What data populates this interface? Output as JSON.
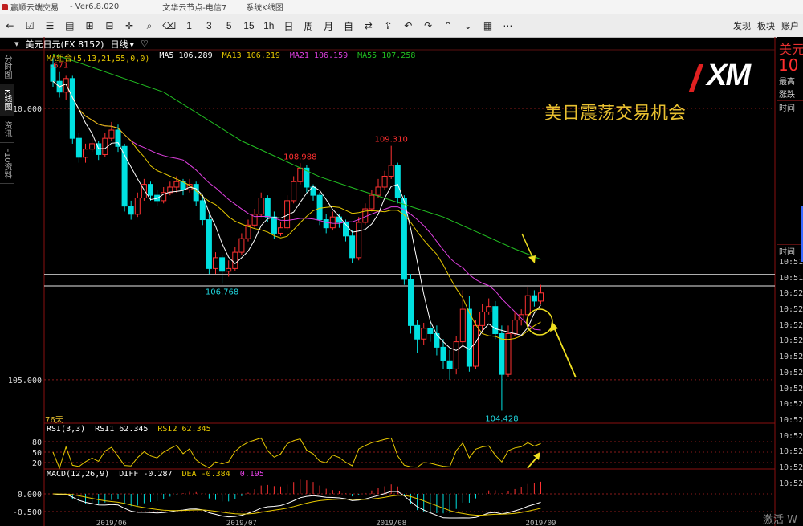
{
  "window": {
    "app_title": "赢顺云端交易",
    "version": "- Ver6.8.020",
    "node": "文华云节点-电信7",
    "chart_type": "系统K线图"
  },
  "toolbar": {
    "left_icons": [
      "back-icon",
      "checkbox-icon",
      "list-icon",
      "document-icon",
      "plus-icon",
      "minus-icon",
      "crosshair-icon",
      "search-icon",
      "eraser-icon"
    ],
    "periods": [
      "1",
      "3",
      "5",
      "15",
      "1h",
      "日",
      "周",
      "月",
      "自"
    ],
    "right_icons": [
      "swap-icon",
      "upload-icon",
      "undo-icon",
      "redo-icon",
      "chevron-up-icon",
      "chevron-down-icon",
      "grid-icon",
      "more-icon"
    ],
    "right_links": [
      "发现",
      "板块",
      "账户"
    ]
  },
  "left_tabs": [
    "分时图",
    "K线图",
    "资讯",
    "F10资料"
  ],
  "symbol": {
    "name": "美元日元(FX 8152)",
    "period": "日线"
  },
  "ma_legend": {
    "group": "MA组合(5,13,21,55,0,0)",
    "ma5": "MA5 106.289",
    "ma13": "MA13 106.219",
    "ma21": "MA21 106.159",
    "ma55": "MA55 107.258"
  },
  "rsi_legend": {
    "name": "RSI(3,3)",
    "rsi1": "RSI1 62.345",
    "rsi2": "RSI2 62.345"
  },
  "macd_legend": {
    "name": "MACD(12,26,9)",
    "diff": "DIFF -0.287",
    "dea": "DEA -0.384",
    "macd": "0.195"
  },
  "overlay": {
    "caption": "美日震荡交易机会",
    "logo": "XM",
    "days": "76天"
  },
  "side_panel": {
    "symbol": "美元",
    "price": "10",
    "high_label": "最高",
    "change_label": "涨跌",
    "time_header": "时间",
    "time_header2": "时间",
    "times": [
      "10:51",
      "10:51",
      "10:52",
      "10:52",
      "10:52",
      "10:52",
      "10:52",
      "10:52",
      "10:52",
      "10:52",
      "10:52",
      "10:52",
      "10:52",
      "10:52",
      "10:52"
    ]
  },
  "watermark": "激活 W",
  "colors": {
    "up": "#ff3232",
    "down": "#00e0e0",
    "ma5": "#ffffff",
    "ma13": "#e6c800",
    "ma21": "#e040e0",
    "ma55": "#22c022",
    "annotation_arrow": "#f0e020",
    "grid": "#8a1a1a"
  },
  "chart_data": {
    "type": "candlestick",
    "ylim": [
      104.2,
      111.08
    ],
    "y_axis": {
      "ticks": [
        {
          "value": 110.0,
          "label": "110.000"
        },
        {
          "value": 105.0,
          "label": "105.000"
        }
      ]
    },
    "ohlc": [
      [
        110.8,
        110.95,
        110.4,
        110.5
      ],
      [
        110.5,
        110.67,
        110.2,
        110.3
      ],
      [
        110.3,
        110.6,
        110.15,
        110.55
      ],
      [
        110.55,
        110.6,
        109.35,
        109.45
      ],
      [
        109.45,
        109.55,
        109.0,
        109.1
      ],
      [
        109.1,
        109.35,
        109.0,
        109.25
      ],
      [
        109.25,
        109.45,
        109.2,
        109.35
      ],
      [
        109.35,
        109.4,
        109.05,
        109.15
      ],
      [
        109.15,
        109.55,
        109.1,
        109.45
      ],
      [
        109.45,
        109.75,
        109.4,
        109.6
      ],
      [
        109.6,
        109.7,
        109.2,
        109.3
      ],
      [
        109.3,
        109.35,
        108.1,
        108.2
      ],
      [
        108.2,
        108.3,
        107.95,
        108.05
      ],
      [
        108.05,
        108.45,
        108.0,
        108.35
      ],
      [
        108.35,
        108.7,
        108.3,
        108.6
      ],
      [
        108.6,
        108.65,
        108.3,
        108.4
      ],
      [
        108.4,
        108.5,
        108.2,
        108.3
      ],
      [
        108.3,
        108.55,
        108.25,
        108.45
      ],
      [
        108.45,
        108.65,
        108.4,
        108.55
      ],
      [
        108.55,
        108.75,
        108.45,
        108.65
      ],
      [
        108.65,
        108.7,
        108.4,
        108.5
      ],
      [
        108.5,
        108.7,
        108.45,
        108.6
      ],
      [
        108.6,
        108.65,
        108.2,
        108.3
      ],
      [
        108.3,
        108.4,
        107.85,
        107.95
      ],
      [
        107.95,
        108.05,
        106.95,
        107.05
      ],
      [
        107.05,
        107.35,
        106.95,
        107.25
      ],
      [
        107.25,
        107.3,
        106.77,
        107.0
      ],
      [
        107.0,
        107.2,
        106.9,
        107.05
      ],
      [
        107.05,
        107.45,
        107.0,
        107.35
      ],
      [
        107.35,
        107.7,
        107.3,
        107.6
      ],
      [
        107.6,
        107.95,
        107.55,
        107.85
      ],
      [
        107.85,
        108.15,
        107.8,
        108.05
      ],
      [
        108.05,
        108.45,
        108.0,
        108.35
      ],
      [
        108.35,
        108.4,
        107.9,
        108.0
      ],
      [
        108.0,
        108.1,
        107.6,
        107.7
      ],
      [
        107.7,
        107.9,
        107.65,
        107.8
      ],
      [
        107.8,
        108.4,
        107.75,
        108.3
      ],
      [
        108.3,
        108.75,
        108.25,
        108.65
      ],
      [
        108.65,
        108.99,
        108.6,
        108.9
      ],
      [
        108.9,
        108.95,
        108.45,
        108.55
      ],
      [
        108.55,
        108.6,
        108.3,
        108.4
      ],
      [
        108.4,
        108.45,
        107.85,
        107.95
      ],
      [
        107.95,
        108.05,
        107.7,
        107.8
      ],
      [
        107.8,
        108.1,
        107.75,
        108.0
      ],
      [
        108.0,
        108.05,
        107.8,
        107.9
      ],
      [
        107.9,
        107.95,
        107.55,
        107.65
      ],
      [
        107.65,
        107.75,
        107.15,
        107.25
      ],
      [
        107.25,
        108.0,
        107.2,
        107.9
      ],
      [
        107.9,
        108.25,
        107.85,
        108.15
      ],
      [
        108.15,
        108.5,
        108.1,
        108.4
      ],
      [
        108.4,
        108.7,
        108.35,
        108.55
      ],
      [
        108.55,
        108.85,
        108.5,
        108.75
      ],
      [
        108.75,
        109.31,
        108.7,
        108.95
      ],
      [
        108.95,
        109.0,
        108.25,
        108.35
      ],
      [
        108.35,
        108.4,
        106.75,
        106.85
      ],
      [
        106.85,
        106.95,
        105.85,
        106.0
      ],
      [
        106.0,
        106.1,
        105.5,
        105.75
      ],
      [
        105.75,
        106.05,
        105.65,
        105.95
      ],
      [
        105.95,
        106.1,
        105.7,
        105.85
      ],
      [
        105.85,
        106.0,
        105.45,
        105.6
      ],
      [
        105.6,
        105.75,
        105.2,
        105.35
      ],
      [
        105.35,
        105.55,
        105.0,
        105.2
      ],
      [
        105.2,
        105.8,
        105.1,
        105.7
      ],
      [
        105.7,
        106.65,
        105.6,
        106.3
      ],
      [
        106.3,
        106.55,
        105.15,
        105.25
      ],
      [
        105.25,
        106.1,
        105.2,
        106.0
      ],
      [
        106.0,
        106.4,
        105.9,
        106.25
      ],
      [
        106.25,
        106.5,
        106.2,
        106.35
      ],
      [
        106.35,
        106.45,
        105.75,
        105.85
      ],
      [
        105.85,
        106.0,
        104.43,
        105.1
      ],
      [
        105.1,
        106.0,
        105.05,
        105.85
      ],
      [
        105.85,
        106.25,
        105.8,
        106.1
      ],
      [
        106.1,
        106.3,
        106.0,
        106.2
      ],
      [
        106.2,
        106.7,
        106.15,
        106.55
      ],
      [
        106.55,
        106.65,
        106.35,
        106.45
      ],
      [
        106.45,
        106.75,
        106.4,
        106.6
      ]
    ],
    "ma55": [
      [
        0,
        111.0
      ],
      [
        4,
        110.84
      ],
      [
        17,
        110.3
      ],
      [
        29,
        109.4
      ],
      [
        41,
        108.74
      ],
      [
        47,
        108.5
      ],
      [
        60,
        108.0
      ],
      [
        71,
        107.41
      ],
      [
        75,
        107.22
      ]
    ],
    "hlines": [
      106.94,
      106.73
    ],
    "annotations": [
      {
        "index": 1,
        "price": 110.67,
        "text": ".671",
        "color": "#ff3030",
        "pos": "above"
      },
      {
        "index": 38,
        "price": 108.99,
        "text": "108.988",
        "color": "#ff3030",
        "pos": "above"
      },
      {
        "index": 52,
        "price": 109.31,
        "text": "109.310",
        "color": "#ff3030",
        "pos": "above"
      },
      {
        "index": 26,
        "price": 106.77,
        "text": "106.768",
        "color": "#20d8e0",
        "pos": "below"
      },
      {
        "index": 69,
        "price": 104.43,
        "text": "104.428",
        "color": "#20d8e0",
        "pos": "below"
      }
    ],
    "x_ticks": [
      {
        "index": 9,
        "label": "2019/06"
      },
      {
        "index": 29,
        "label": "2019/07"
      },
      {
        "index": 52,
        "label": "2019/08"
      },
      {
        "index": 75,
        "label": "2019/09"
      }
    ],
    "rsi": {
      "ylim": [
        4,
        126
      ],
      "ticks": [
        {
          "value": 80,
          "label": "80"
        },
        {
          "value": 50,
          "label": "50"
        },
        {
          "value": 20,
          "label": "20"
        }
      ]
    },
    "macd": {
      "ylim": [
        -0.68,
        0.68
      ],
      "ticks": [
        {
          "value": 0,
          "label": "0.000"
        },
        {
          "value": -0.5,
          "label": "-0.500"
        }
      ]
    }
  }
}
